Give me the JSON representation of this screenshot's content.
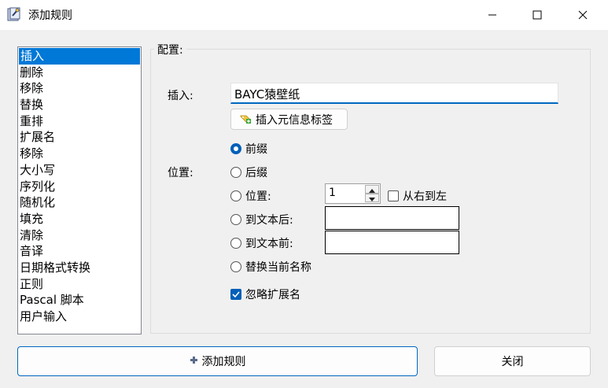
{
  "window": {
    "title": "添加规则",
    "app_icon": "app-icon",
    "controls": [
      "minimize-icon",
      "maximize-icon",
      "close-icon"
    ]
  },
  "rule_list": {
    "items": [
      "插入",
      "删除",
      "移除",
      "替换",
      "重排",
      "扩展名",
      "移除",
      "大小写",
      "序列化",
      "随机化",
      "填充",
      "清除",
      "音译",
      "日期格式转换",
      "正则",
      "Pascal 脚本",
      "用户输入"
    ],
    "selected_index": 0
  },
  "config": {
    "group_label": "配置:",
    "insert_label": "插入:",
    "insert_value": "BAYC猿壁纸",
    "meta_button_label": "插入元信息标签",
    "position_label": "位置:",
    "options": {
      "prefix": "前缀",
      "suffix": "后缀",
      "position": "位置:",
      "after_text": "到文本后:",
      "before_text": "到文本前:",
      "replace_name": "替换当前名称"
    },
    "selected_option": "prefix",
    "position_value": "1",
    "right_to_left_label": "从右到左",
    "right_to_left_checked": false,
    "ignore_ext_label": "忽略扩展名",
    "ignore_ext_checked": true
  },
  "footer": {
    "add_rule_label": "添加规则",
    "close_label": "关闭"
  },
  "colors": {
    "accent": "#0078d7",
    "selection": "#0078d7"
  }
}
